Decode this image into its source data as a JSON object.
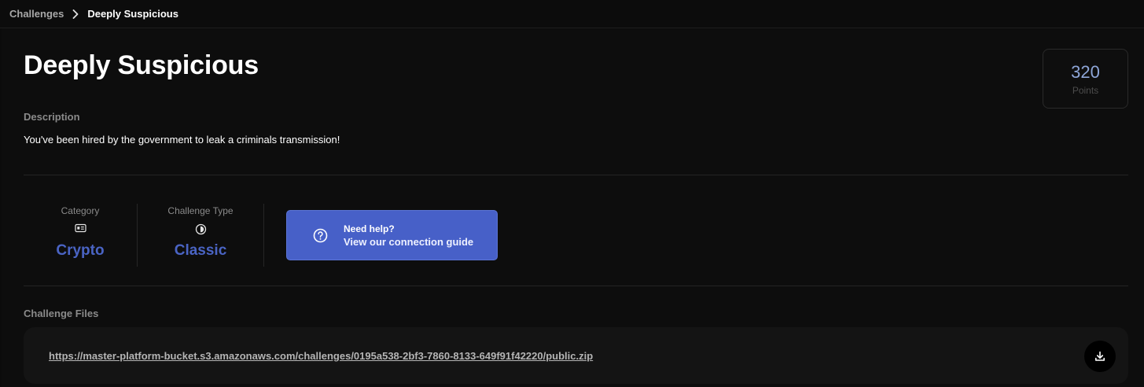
{
  "breadcrumb": {
    "parent": "Challenges",
    "current": "Deeply Suspicious",
    "separator_icon": "chevron-right-icon"
  },
  "challenge": {
    "title": "Deeply Suspicious",
    "points": {
      "value": "320",
      "label": "Points",
      "color": "#8ea6d8"
    },
    "description_label": "Description",
    "description": "You've been hired by the government to leak a criminals transmission!"
  },
  "meta": {
    "category": {
      "label": "Category",
      "icon": "id-card-icon",
      "value": "Crypto"
    },
    "type": {
      "label": "Challenge Type",
      "icon": "half-circle-icon",
      "value": "Classic"
    },
    "accent_color": "#4a64c4"
  },
  "help": {
    "icon": "question-circle-icon",
    "title": "Need help?",
    "subtitle": "View our connection guide",
    "background": "#4760c8"
  },
  "files": {
    "label": "Challenge Files",
    "items": [
      {
        "url": "https://master-platform-bucket.s3.amazonaws.com/challenges/0195a538-2bf3-7860-8133-649f91f42220/public.zip",
        "action_icon": "download-icon"
      }
    ]
  }
}
